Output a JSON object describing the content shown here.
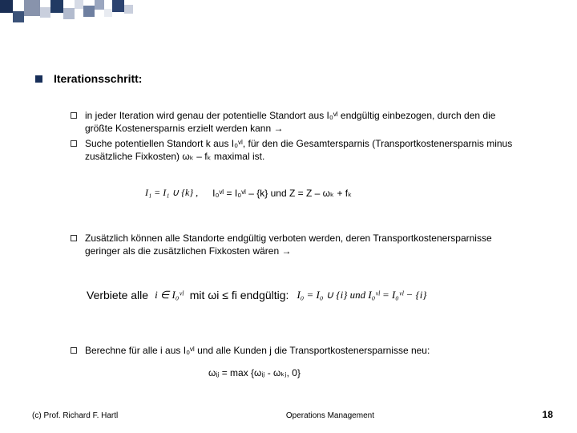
{
  "heading": "Iterationsschritt:",
  "items": {
    "i1": "in jeder Iteration wird genau der potentielle Standort aus I₀ᵛˡ endgültig einbezogen, durch den die größte Kostenersparnis erzielt werden kann →",
    "i2": "Suche potentiellen Standort k aus I₀ᵛˡ, für den die Gesamtersparnis (Transportkostenersparnis minus zusätzliche Fixkosten) ωₖ – fₖ maximal ist.",
    "i3": "Zusätzlich können alle Standorte endgültig verboten werden, deren Transportkostenersparnisse geringer als die zusätzlichen Fixkosten wären →",
    "i4": "Berechne für alle i aus I₀ᵛˡ und alle Kunden j die Transportkostenersparnisse neu:"
  },
  "formula1_left": "I₁ = I₁ ∪ {k} ,",
  "formula1_right": "I₀ᵛˡ = I₀ᵛˡ – {k} und Z = Z – ωₖ + fₖ",
  "verbiete": {
    "pre": "Verbiete alle",
    "mid_formula": "i ∈ I₀ᵛˡ",
    "mid_text": "mit ωi ≤ fi endgültig:",
    "post_formula": "I₀ = I₀ ∪ {i} und I₀ᵛˡ = I₀ᵛˡ − {i}"
  },
  "formula2": "ωᵢⱼ = max {ωᵢⱼ - ωₖⱼ, 0}",
  "footer": {
    "left": "(c) Prof. Richard F. Hartl",
    "center": "Operations Management",
    "page": "18"
  },
  "deco_colors": [
    "#1a2e54",
    "#3b5279",
    "#8893ac",
    "#fff",
    "#213a63",
    "#b2bbce",
    "#fff",
    "#6e7fa0",
    "#9aa6bf",
    "#fff",
    "#2c4370",
    "#c9cfdd"
  ]
}
